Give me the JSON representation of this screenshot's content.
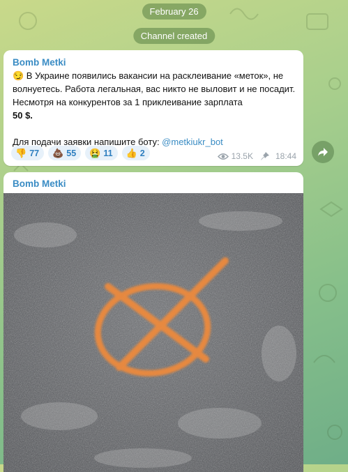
{
  "chat": {
    "date_label": "February 26",
    "service_label": "Channel created"
  },
  "messages": [
    {
      "author": "Bomb Metki",
      "lines": [
        "😏 В Украине появились вакансии на расклеивание «меток», не волнуетесь. Работа легальная, вас никто не выловит и не посадит. Несмотря на конкурентов за 1 приклеивание зарплата",
        "50 $."
      ],
      "cta_text": "Для подачи заявки напишите боту: ",
      "bot_handle": "@metkiukr_bot",
      "reactions": [
        {
          "emoji": "👎",
          "count": "77"
        },
        {
          "emoji": "💩",
          "count": "55"
        },
        {
          "emoji": "🤮",
          "count": "11"
        },
        {
          "emoji": "👍",
          "count": "2"
        }
      ],
      "views": "13.5K",
      "time": "18:44",
      "icons": [
        "eye-icon",
        "pin-icon",
        "share-icon"
      ]
    },
    {
      "author": "Bomb Metki",
      "photo": "orange-spray-circle-cross-on-asphalt"
    }
  ]
}
